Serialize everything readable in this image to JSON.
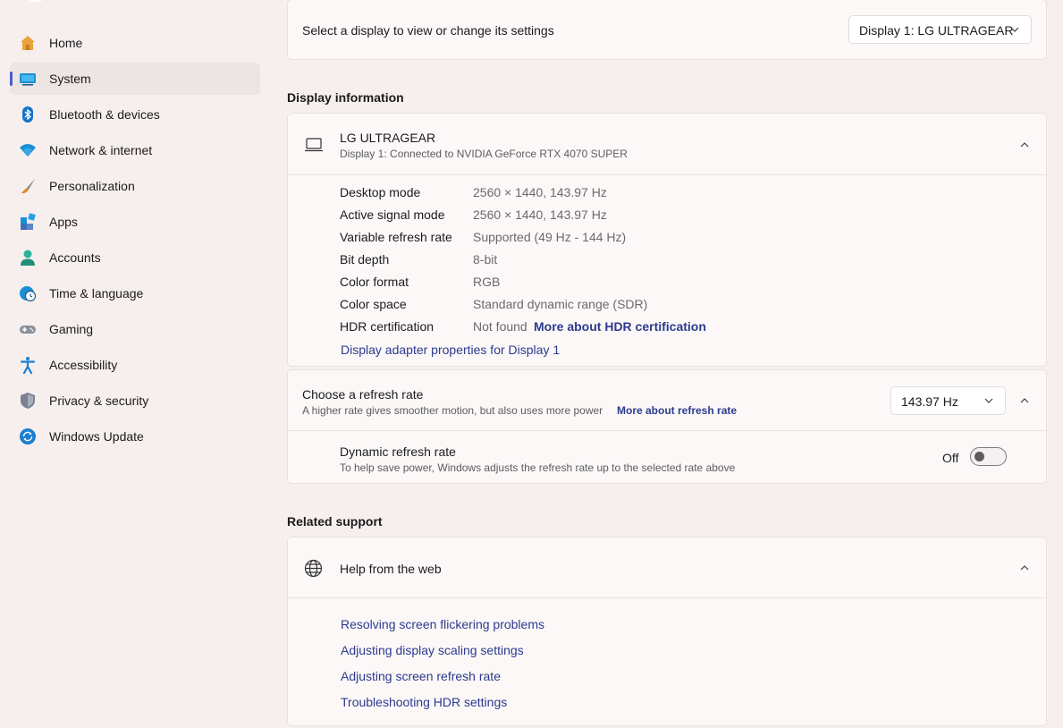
{
  "sidebar": {
    "items": [
      {
        "label": "Home",
        "icon": "home-icon"
      },
      {
        "label": "System",
        "icon": "system-icon",
        "selected": true
      },
      {
        "label": "Bluetooth & devices",
        "icon": "bluetooth-icon"
      },
      {
        "label": "Network & internet",
        "icon": "wifi-icon"
      },
      {
        "label": "Personalization",
        "icon": "paintbrush-icon"
      },
      {
        "label": "Apps",
        "icon": "apps-icon"
      },
      {
        "label": "Accounts",
        "icon": "person-icon"
      },
      {
        "label": "Time & language",
        "icon": "globe-clock-icon"
      },
      {
        "label": "Gaming",
        "icon": "gamepad-icon"
      },
      {
        "label": "Accessibility",
        "icon": "accessibility-icon"
      },
      {
        "label": "Privacy & security",
        "icon": "shield-icon"
      },
      {
        "label": "Windows Update",
        "icon": "update-icon"
      }
    ]
  },
  "select_display": {
    "label": "Select a display to view or change its settings",
    "value": "Display 1: LG ULTRAGEAR"
  },
  "display_info": {
    "section_title": "Display information",
    "monitor_name": "LG ULTRAGEAR",
    "monitor_sub": "Display 1: Connected to NVIDIA GeForce RTX 4070 SUPER",
    "rows": [
      {
        "label": "Desktop mode",
        "value": "2560 × 1440, 143.97 Hz"
      },
      {
        "label": "Active signal mode",
        "value": "2560 × 1440, 143.97 Hz"
      },
      {
        "label": "Variable refresh rate",
        "value": "Supported (49 Hz - 144 Hz)"
      },
      {
        "label": "Bit depth",
        "value": "8-bit"
      },
      {
        "label": "Color format",
        "value": "RGB"
      },
      {
        "label": "Color space",
        "value": "Standard dynamic range (SDR)"
      },
      {
        "label": "HDR certification",
        "value": "Not found",
        "link": "More about HDR certification"
      }
    ],
    "adapter_link": "Display adapter properties for Display 1"
  },
  "refresh": {
    "title": "Choose a refresh rate",
    "description": "A higher rate gives smoother motion, but also uses more power",
    "link": "More about refresh rate",
    "value": "143.97 Hz",
    "dynamic_title": "Dynamic refresh rate",
    "dynamic_desc": "To help save power, Windows adjusts the refresh rate up to the selected rate above",
    "toggle_state": "Off"
  },
  "support": {
    "section_title": "Related support",
    "help_title": "Help from the web",
    "links": [
      "Resolving screen flickering problems",
      "Adjusting display scaling settings",
      "Adjusting screen refresh rate",
      "Troubleshooting HDR settings"
    ]
  },
  "colors": {
    "accent": "#4b5fc7",
    "link": "#2c3a8f",
    "background": "#f6efee"
  }
}
